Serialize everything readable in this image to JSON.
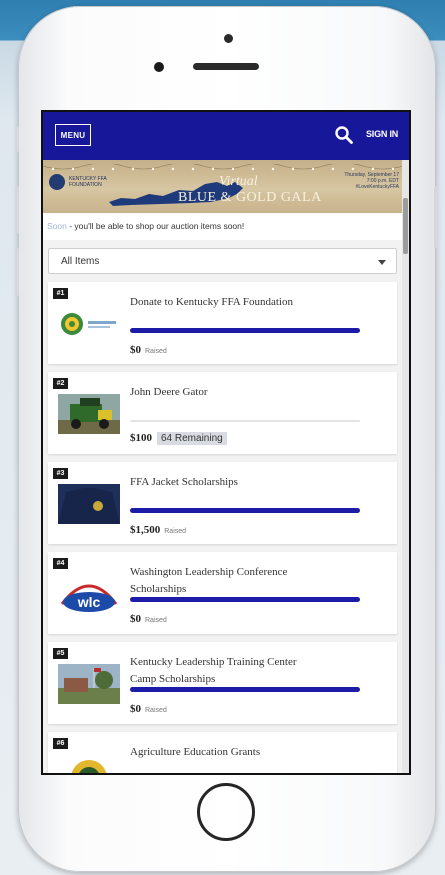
{
  "header": {
    "menu_label": "MENU",
    "signin_label": "SIGN IN",
    "icons": {
      "search": "search-icon"
    }
  },
  "banner": {
    "org_text": "KENTUCKY FFA FOUNDATION",
    "title_line1": "Virtual",
    "title_line2": "BLUE & GOLD GALA",
    "date_text": "Thursday, September 17 7:00 p.m. EDT #LoveKentuckyFFA"
  },
  "notice": {
    "faded_text": "Soon",
    "text": " - you'll be able to shop our auction items soon!"
  },
  "filter": {
    "selected": "All Items"
  },
  "items": [
    {
      "number": "#1",
      "title_line1": "Donate to Kentucky FFA Foundation",
      "title_line2": "",
      "amount": "$0",
      "status": "Raised",
      "progress": 0.0
    },
    {
      "number": "#2",
      "title_line1": "John Deere Gator",
      "title_line2": "",
      "amount": "$100",
      "status": "64 Remaining"
    },
    {
      "number": "#3",
      "title_line1": "FFA Jacket Scholarships",
      "title_line2": "",
      "amount": "$1,500",
      "status": "Raised"
    },
    {
      "number": "#4",
      "title_line1": "Washington Leadership Conference",
      "title_line2": "Scholarships",
      "amount": "$0",
      "status": "Raised"
    },
    {
      "number": "#5",
      "title_line1": "Kentucky Leadership Training Center",
      "title_line2": "Camp Scholarships",
      "amount": "$0",
      "status": "Raised"
    },
    {
      "number": "#6",
      "title_line1": "Agriculture Education Grants",
      "title_line2": "",
      "amount": "",
      "status": ""
    }
  ],
  "thumbs": {
    "item1_caption": "KENTUCKY FFA FOUNDATION",
    "item4_logo_text": "wlc"
  },
  "colors": {
    "navbar": "#17179a",
    "progress": "#1c1ca8",
    "banner": "#d7c6a2"
  }
}
